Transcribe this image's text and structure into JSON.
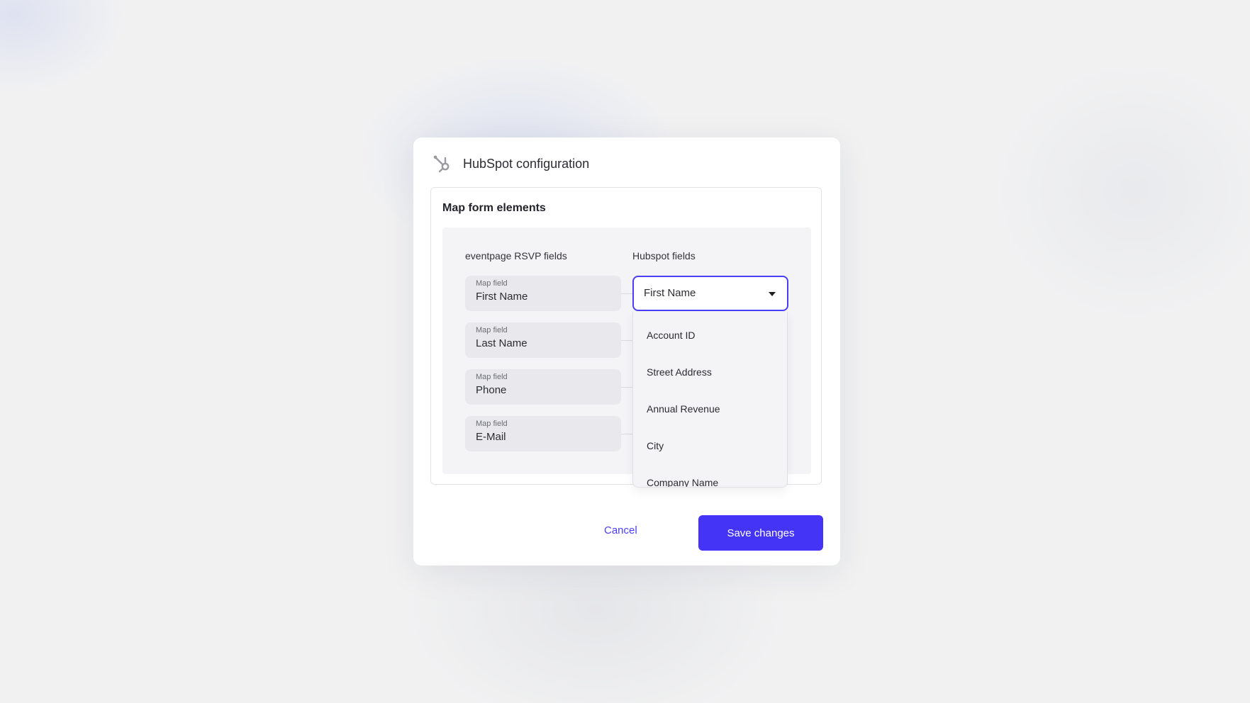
{
  "modal": {
    "title": "HubSpot configuration",
    "icon": "hubspot-logo-icon"
  },
  "card": {
    "title": "Map form elements",
    "left_header": "eventpage RSVP fields",
    "right_header": "Hubspot fields"
  },
  "fields": [
    {
      "label": "Map field",
      "value": "First Name"
    },
    {
      "label": "Map field",
      "value": "Last Name"
    },
    {
      "label": "Map field",
      "value": "Phone"
    },
    {
      "label": "Map field",
      "value": "E-Mail"
    }
  ],
  "hubspot_select": {
    "selected": "First Name",
    "options": [
      "Account ID",
      "Street Address",
      "Annual Revenue",
      "City",
      "Company Name"
    ]
  },
  "actions": {
    "cancel_label": "Cancel",
    "save_label": "Save changes"
  },
  "colors": {
    "accent": "#4434f5",
    "focus_border": "#4a3ff3"
  }
}
